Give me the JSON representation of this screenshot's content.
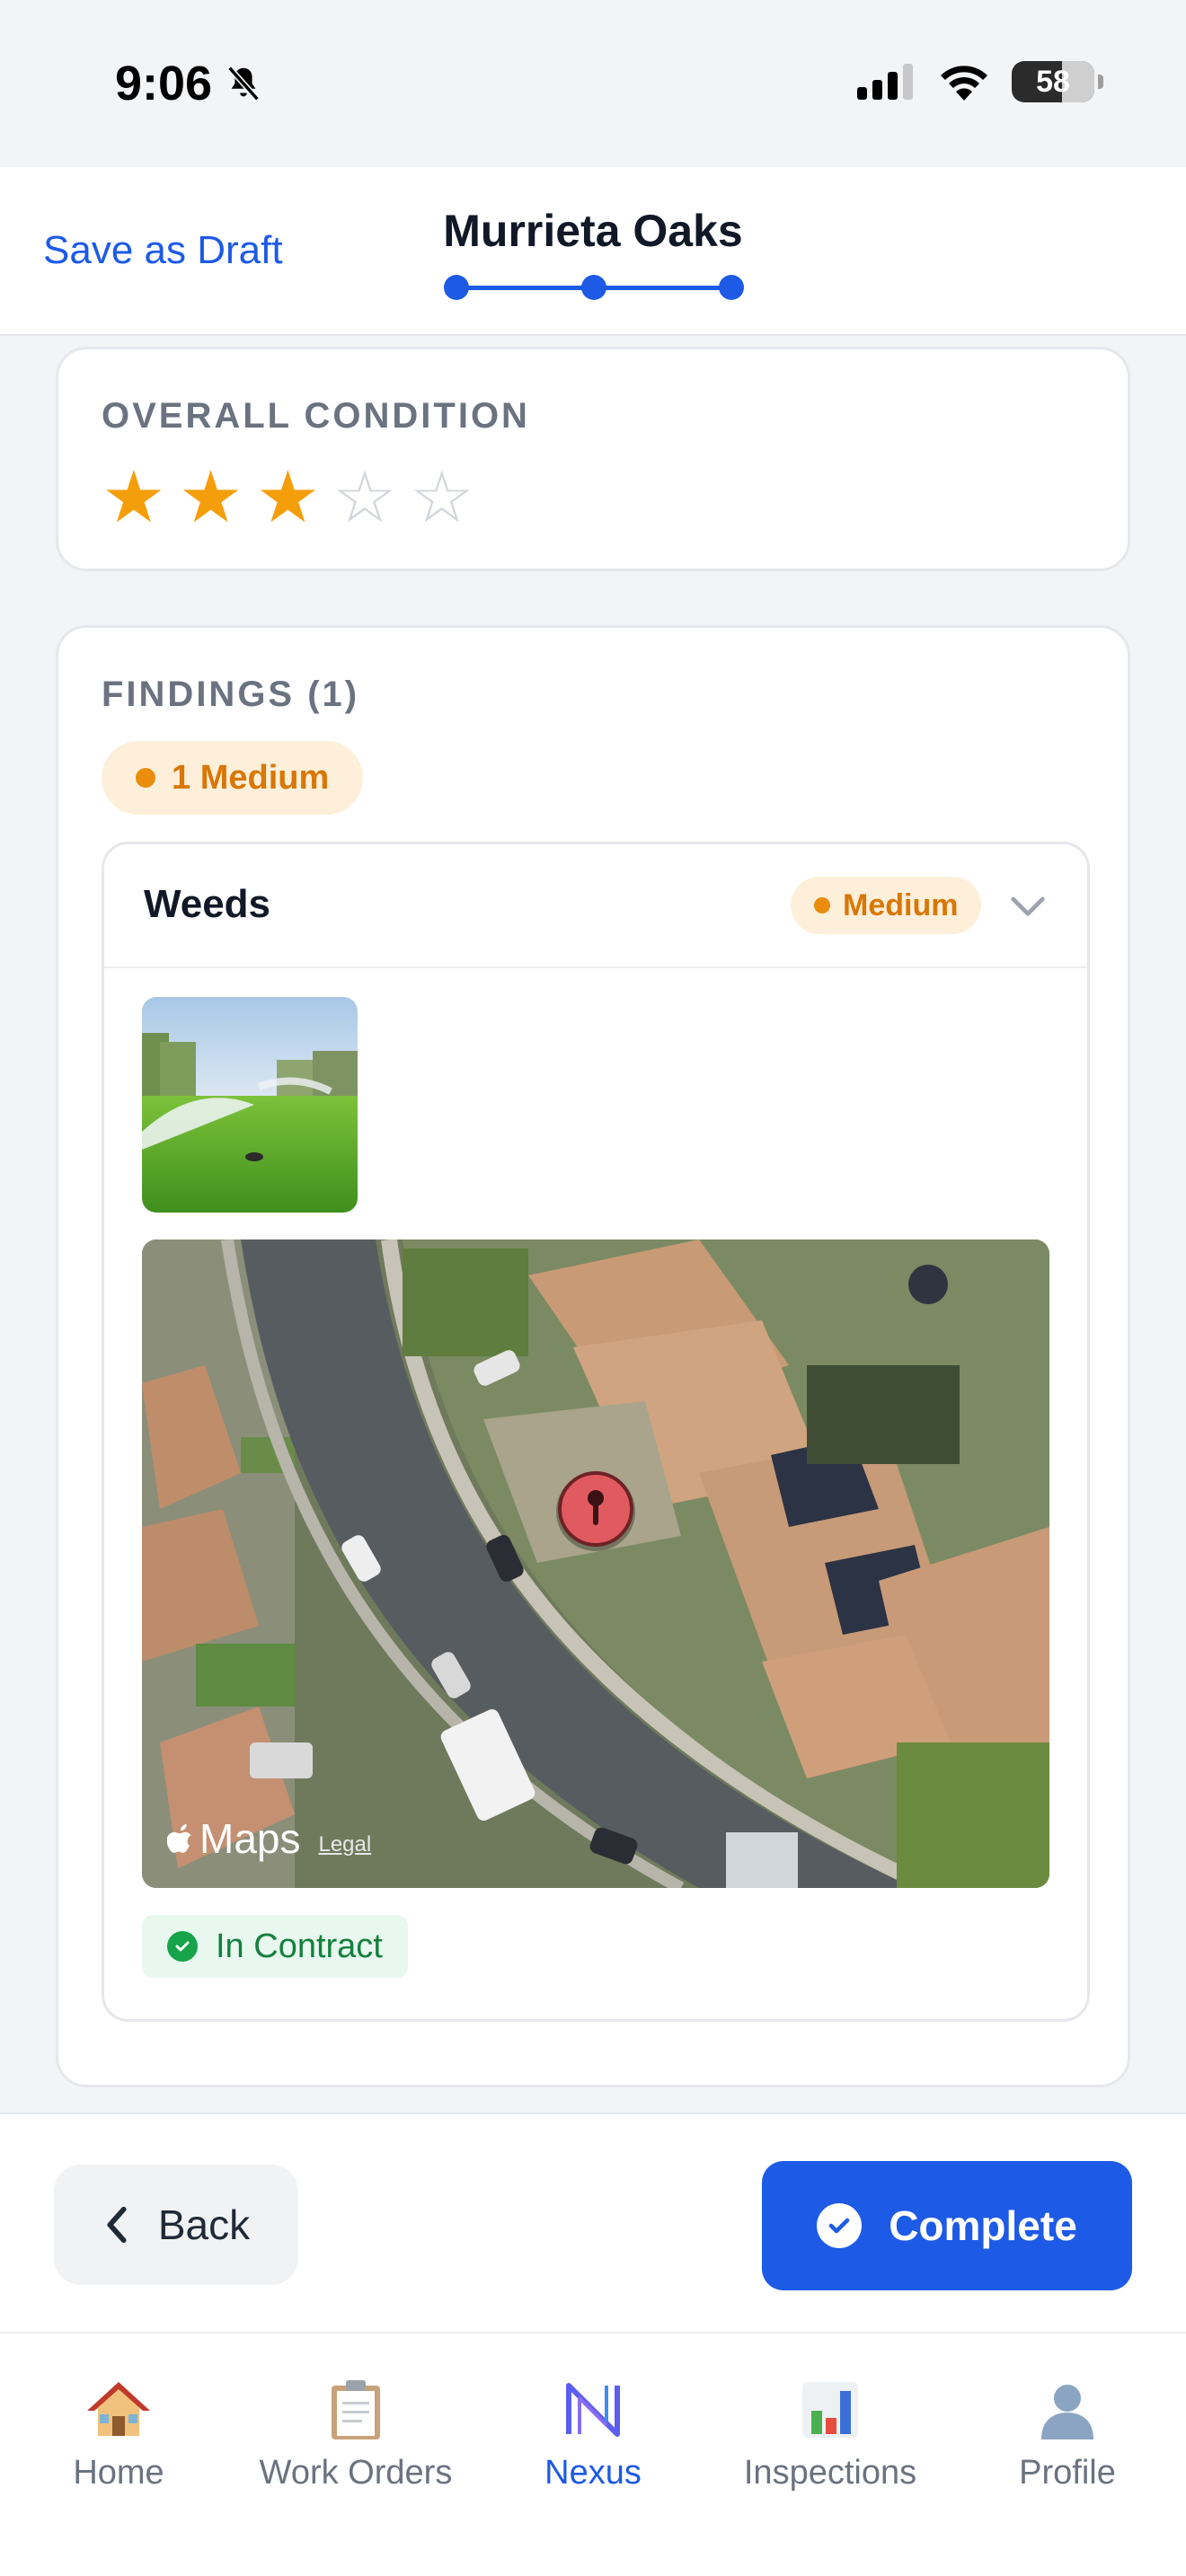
{
  "status_bar": {
    "time": "9:06",
    "battery": "58"
  },
  "header": {
    "save_draft_label": "Save as Draft",
    "title": "Murrieta Oaks",
    "steps_total": 3,
    "steps_completed": 3
  },
  "condition": {
    "label": "OVERALL CONDITION",
    "rating": 3,
    "max_rating": 5
  },
  "findings": {
    "label": "FINDINGS (1)",
    "summary_pill": "1 Medium",
    "items": [
      {
        "title": "Weeds",
        "severity": "Medium",
        "photo_icon": "sprinkler-lawn-photo",
        "map_attribution": "Maps",
        "map_legal": "Legal",
        "contract_status": "In Contract"
      }
    ]
  },
  "actions": {
    "back_label": "Back",
    "complete_label": "Complete"
  },
  "tab_bar": {
    "items": [
      {
        "label": "Home",
        "icon": "house-icon"
      },
      {
        "label": "Work Orders",
        "icon": "clipboard-icon"
      },
      {
        "label": "Nexus",
        "icon": "nexus-logo-icon"
      },
      {
        "label": "Inspections",
        "icon": "bar-chart-icon"
      },
      {
        "label": "Profile",
        "icon": "person-icon"
      }
    ],
    "active": "Nexus"
  },
  "colors": {
    "accent": "#1d5ae6",
    "star": "#f59e0b",
    "medium": "#d97706",
    "contract": "#16a34a"
  }
}
